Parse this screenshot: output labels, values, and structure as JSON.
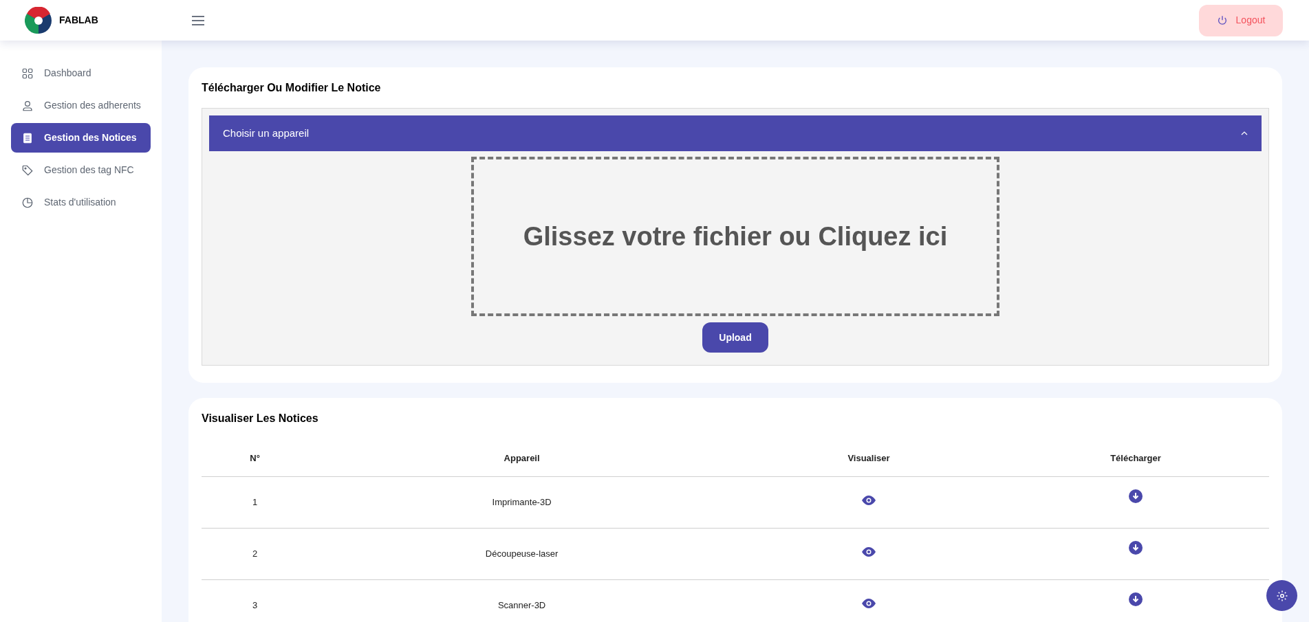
{
  "header": {
    "brand": "FABLAB",
    "logout": "Logout"
  },
  "sidebar": {
    "items": [
      {
        "label": "Dashboard",
        "kind": "grid",
        "selected": false
      },
      {
        "label": "Gestion des adherents",
        "kind": "user",
        "selected": false
      },
      {
        "label": "Gestion des Notices",
        "kind": "document",
        "selected": true
      },
      {
        "label": "Gestion des tag NFC",
        "kind": "tag",
        "selected": false
      },
      {
        "label": "Stats d'utilisation",
        "kind": "clock",
        "selected": false
      }
    ]
  },
  "upload_card": {
    "title": "Télécharger Ou Modifier Le Notice",
    "accordion": {
      "label": "Choisir un appareil",
      "expanded": true
    },
    "dropzone": "Glissez votre fichier ou Cliquez ici",
    "button": "Upload"
  },
  "notices_card": {
    "title": "Visualiser Les Notices",
    "columns": [
      "N°",
      "Appareil",
      "Visualiser",
      "Télécharger"
    ],
    "rows": [
      {
        "number": "1",
        "device": "Imprimante-3D"
      },
      {
        "number": "2",
        "device": "Découpeuse-laser"
      },
      {
        "number": "3",
        "device": "Scanner-3D"
      }
    ]
  }
}
